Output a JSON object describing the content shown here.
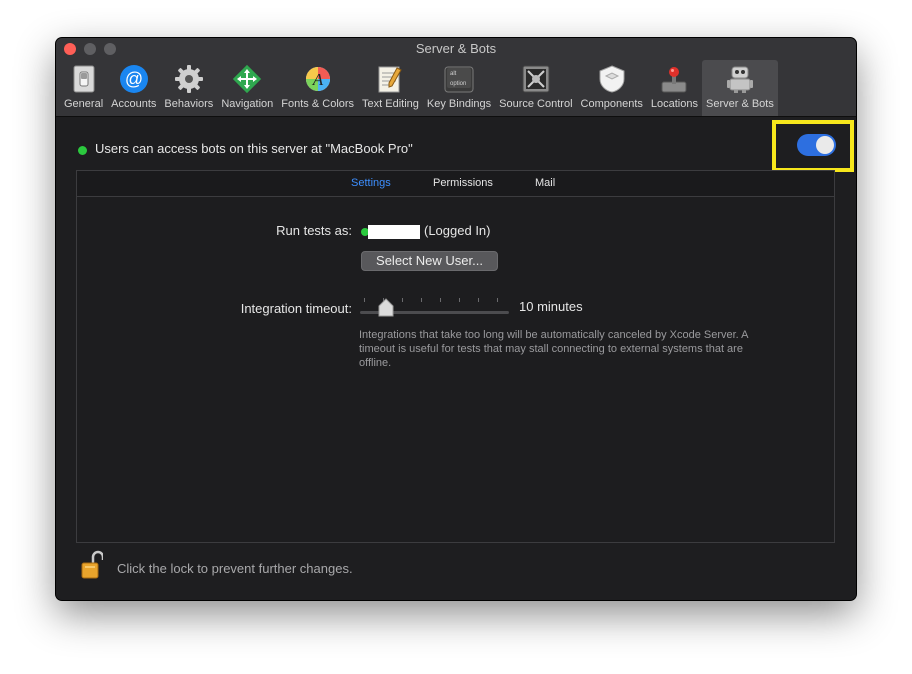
{
  "window": {
    "title": "Server & Bots"
  },
  "toolbar": {
    "items": [
      {
        "label": "General",
        "icon": "general-switch-icon"
      },
      {
        "label": "Accounts",
        "icon": "at-sign-icon"
      },
      {
        "label": "Behaviors",
        "icon": "gear-icon"
      },
      {
        "label": "Navigation",
        "icon": "navigation-arrows-icon"
      },
      {
        "label": "Fonts & Colors",
        "icon": "color-font-icon"
      },
      {
        "label": "Text Editing",
        "icon": "notepad-pencil-icon"
      },
      {
        "label": "Key Bindings",
        "icon": "option-key-icon",
        "key_top": "alt",
        "key_bottom": "option"
      },
      {
        "label": "Source Control",
        "icon": "source-control-icon"
      },
      {
        "label": "Components",
        "icon": "shield-box-icon"
      },
      {
        "label": "Locations",
        "icon": "joystick-icon"
      },
      {
        "label": "Server & Bots",
        "icon": "robot-icon",
        "selected": true
      }
    ]
  },
  "status": {
    "text": "Users can access bots on this server at \"MacBook Pro\"",
    "enabled": true
  },
  "tabs": [
    {
      "label": "Settings",
      "selected": true
    },
    {
      "label": "Permissions",
      "selected": false
    },
    {
      "label": "Mail",
      "selected": false
    }
  ],
  "settings": {
    "run_tests_label": "Run tests as:",
    "user_state": "(Logged In)",
    "select_user_button": "Select New User...",
    "timeout_label": "Integration timeout:",
    "timeout_value": "10 minutes",
    "timeout_level": 0.15,
    "help_text": "Integrations that take too long will be automatically canceled by Xcode Server.  A timeout is useful for tests that may stall connecting to external systems that are offline."
  },
  "footer": {
    "lock_text": "Click the lock to prevent further changes."
  },
  "colors": {
    "accent": "#2d6fe0",
    "status_green": "#2bc93e",
    "highlight": "#f7e71c"
  }
}
